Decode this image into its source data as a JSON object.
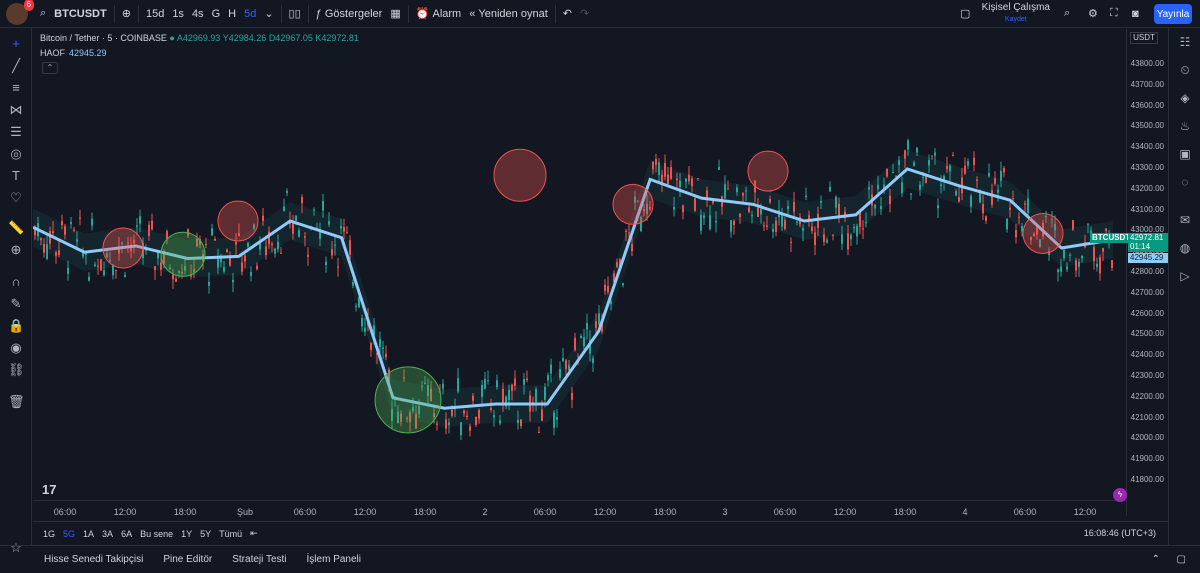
{
  "topbar": {
    "badge": "6",
    "symbol": "BTCUSDT",
    "intervals": [
      "15d",
      "1s",
      "4s",
      "G",
      "H",
      "5d"
    ],
    "indicators": "Göstergeler",
    "alarm": "Alarm",
    "replay": "Yeniden oynat",
    "workspace": "Kişisel Çalışma",
    "save": "Kaydet",
    "publish": "Yayınla"
  },
  "legend": {
    "symbol": "Bitcoin / Tether · 5 · COINBASE",
    "o": "A42969.93",
    "h": "Y42984.26",
    "l": "D42967.05",
    "c": "K42972.81"
  },
  "indicator": {
    "name": "HAOF",
    "value": "42945.29"
  },
  "priceaxis": {
    "currency": "USDT",
    "ticks": [
      "43800.00",
      "43700.00",
      "43600.00",
      "43500.00",
      "43400.00",
      "43300.00",
      "43200.00",
      "43100.00",
      "43000.00",
      "42900.00",
      "42800.00",
      "42700.00",
      "42600.00",
      "42500.00",
      "42400.00",
      "42300.00",
      "42200.00",
      "42100.00",
      "42000.00",
      "41900.00",
      "41800.00"
    ],
    "last_label": "BTCUSDT",
    "last_price": "42972.81",
    "countdown": "01:14",
    "haof_price": "42945.29"
  },
  "timeaxis": [
    "06:00",
    "12:00",
    "18:00",
    "Şub",
    "06:00",
    "12:00",
    "18:00",
    "2",
    "06:00",
    "12:00",
    "18:00",
    "3",
    "06:00",
    "12:00",
    "18:00",
    "4",
    "06:00",
    "12:00"
  ],
  "ranges": [
    "1G",
    "5G",
    "1A",
    "3A",
    "6A",
    "Bu sene",
    "1Y",
    "5Y",
    "Tümü"
  ],
  "clock": "16:08:46 (UTC+3)",
  "footer": [
    "Hisse Senedi Takipçisi",
    "Pine Editör",
    "Strateji Testi",
    "İşlem Paneli"
  ],
  "colors": {
    "up": "#26a69a",
    "down": "#ef5350",
    "haof": "#90caf9",
    "accent": "#2962ff"
  },
  "chart_data": {
    "type": "candlestick",
    "haof_line": [
      43020,
      42900,
      42930,
      42870,
      42880,
      43050,
      42970,
      42200,
      42150,
      42170,
      42170,
      42520,
      43250,
      43160,
      43130,
      43050,
      43080,
      43300,
      43220,
      43150,
      42920,
      42960
    ],
    "signals": [
      {
        "type": "sell",
        "price": 42920
      },
      {
        "type": "buy",
        "price": 42890
      },
      {
        "type": "sell",
        "price": 43050
      },
      {
        "type": "buy",
        "price": 42190
      },
      {
        "type": "sell",
        "price": 43270
      },
      {
        "type": "sell",
        "price": 43130
      },
      {
        "type": "sell",
        "price": 43290
      },
      {
        "type": "sell",
        "price": 42990
      }
    ]
  }
}
